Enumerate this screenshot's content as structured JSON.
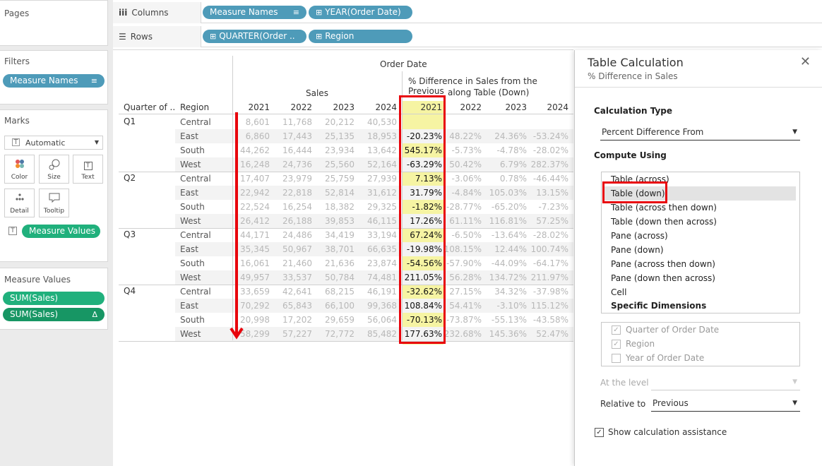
{
  "colors": {
    "pill_blue": "#4e9bb9",
    "pill_green": "#20b07c",
    "highlight": "#f6f4a3",
    "annotation_red": "#e8040c"
  },
  "panes": {
    "pages": "Pages",
    "filters": "Filters",
    "marks": "Marks",
    "measure_values": "Measure Values"
  },
  "filters": {
    "pill": "Measure Names",
    "pill_icon": "sort-icon"
  },
  "marks": {
    "type": "Automatic",
    "buttons": [
      {
        "label": "Color",
        "icon": "color-dots-icon"
      },
      {
        "label": "Size",
        "icon": "size-icon"
      },
      {
        "label": "Text",
        "icon": "text-icon"
      },
      {
        "label": "Detail",
        "icon": "detail-dots-icon"
      },
      {
        "label": "Tooltip",
        "icon": "tooltip-icon"
      }
    ],
    "text_pill": "Measure Values"
  },
  "measure_values": {
    "items": [
      "SUM(Sales)",
      "SUM(Sales)"
    ],
    "delta_icon": "Δ"
  },
  "shelves": {
    "columns": {
      "label": "Columns",
      "icon": "iii",
      "pills": [
        "Measure Names",
        "YEAR(Order Date)"
      ]
    },
    "rows": {
      "label": "Rows",
      "icon": "☰",
      "pills": [
        "QUARTER(Order ..",
        "Region"
      ]
    }
  },
  "view": {
    "top_header": "Order Date",
    "sales_header": "Sales",
    "pct_header_line1": "% Difference in Sales from the Previous",
    "pct_header_line2": "along Table (Down)",
    "row_header_quarter": "Quarter of ..",
    "row_header_region": "Region",
    "years": [
      "2021",
      "2022",
      "2023",
      "2024"
    ],
    "quarters": [
      "Q1",
      "Q2",
      "Q3",
      "Q4"
    ],
    "regions": [
      "Central",
      "East",
      "South",
      "West"
    ],
    "sales": [
      [
        "8,601",
        "11,768",
        "20,212",
        "40,530"
      ],
      [
        "6,860",
        "17,443",
        "25,135",
        "18,953"
      ],
      [
        "44,262",
        "16,444",
        "23,934",
        "13,642"
      ],
      [
        "16,248",
        "24,736",
        "25,560",
        "52,164"
      ],
      [
        "17,407",
        "23,979",
        "25,759",
        "27,939"
      ],
      [
        "22,942",
        "22,818",
        "52,814",
        "31,612"
      ],
      [
        "22,524",
        "16,254",
        "18,382",
        "29,325"
      ],
      [
        "26,412",
        "26,188",
        "39,853",
        "46,115"
      ],
      [
        "44,171",
        "24,486",
        "34,419",
        "33,194"
      ],
      [
        "35,345",
        "50,967",
        "38,701",
        "66,635"
      ],
      [
        "16,061",
        "21,460",
        "21,636",
        "23,874"
      ],
      [
        "49,957",
        "33,537",
        "50,784",
        "74,481"
      ],
      [
        "33,659",
        "42,641",
        "68,215",
        "46,191"
      ],
      [
        "70,292",
        "65,843",
        "66,100",
        "99,368"
      ],
      [
        "20,998",
        "17,202",
        "29,659",
        "56,064"
      ],
      [
        "58,299",
        "57,227",
        "72,772",
        "85,482"
      ]
    ],
    "pct": [
      [
        "",
        "",
        "",
        ""
      ],
      [
        "-20.23%",
        "48.22%",
        "24.36%",
        "-53.24%"
      ],
      [
        "545.17%",
        "-5.73%",
        "-4.78%",
        "-28.02%"
      ],
      [
        "-63.29%",
        "50.42%",
        "6.79%",
        "282.37%"
      ],
      [
        "7.13%",
        "-3.06%",
        "0.78%",
        "-46.44%"
      ],
      [
        "31.79%",
        "-4.84%",
        "105.03%",
        "13.15%"
      ],
      [
        "-1.82%",
        "-28.77%",
        "-65.20%",
        "-7.23%"
      ],
      [
        "17.26%",
        "61.11%",
        "116.81%",
        "57.25%"
      ],
      [
        "67.24%",
        "-6.50%",
        "-13.64%",
        "-28.02%"
      ],
      [
        "-19.98%",
        "108.15%",
        "12.44%",
        "100.74%"
      ],
      [
        "-54.56%",
        "-57.90%",
        "-44.09%",
        "-64.17%"
      ],
      [
        "211.05%",
        "56.28%",
        "134.72%",
        "211.97%"
      ],
      [
        "-32.62%",
        "27.15%",
        "34.32%",
        "-37.98%"
      ],
      [
        "108.84%",
        "54.41%",
        "-3.10%",
        "115.12%"
      ],
      [
        "-70.13%",
        "-73.87%",
        "-55.13%",
        "-43.58%"
      ],
      [
        "177.63%",
        "232.68%",
        "145.36%",
        "52.47%"
      ]
    ]
  },
  "dialog": {
    "title": "Table Calculation",
    "subtitle": "% Difference in Sales",
    "close_icon": "close-icon",
    "calc_type_label": "Calculation Type",
    "calc_type_value": "Percent Difference From",
    "compute_using_label": "Compute Using",
    "compute_options": [
      "Table (across)",
      "Table (down)",
      "Table (across then down)",
      "Table (down then across)",
      "Pane (across)",
      "Pane (down)",
      "Pane (across then down)",
      "Pane (down then across)",
      "Cell"
    ],
    "selected_option": "Table (down)",
    "specific_dimensions": "Specific Dimensions",
    "dimensions": [
      {
        "label": "Quarter of Order Date",
        "checked": true
      },
      {
        "label": "Region",
        "checked": true
      },
      {
        "label": "Year of Order Date",
        "checked": false
      }
    ],
    "at_level_label": "At the level",
    "at_level_value": "",
    "relative_to_label": "Relative to",
    "relative_to_value": "Previous",
    "show_assist_label": "Show calculation assistance",
    "show_assist_checked": true
  }
}
